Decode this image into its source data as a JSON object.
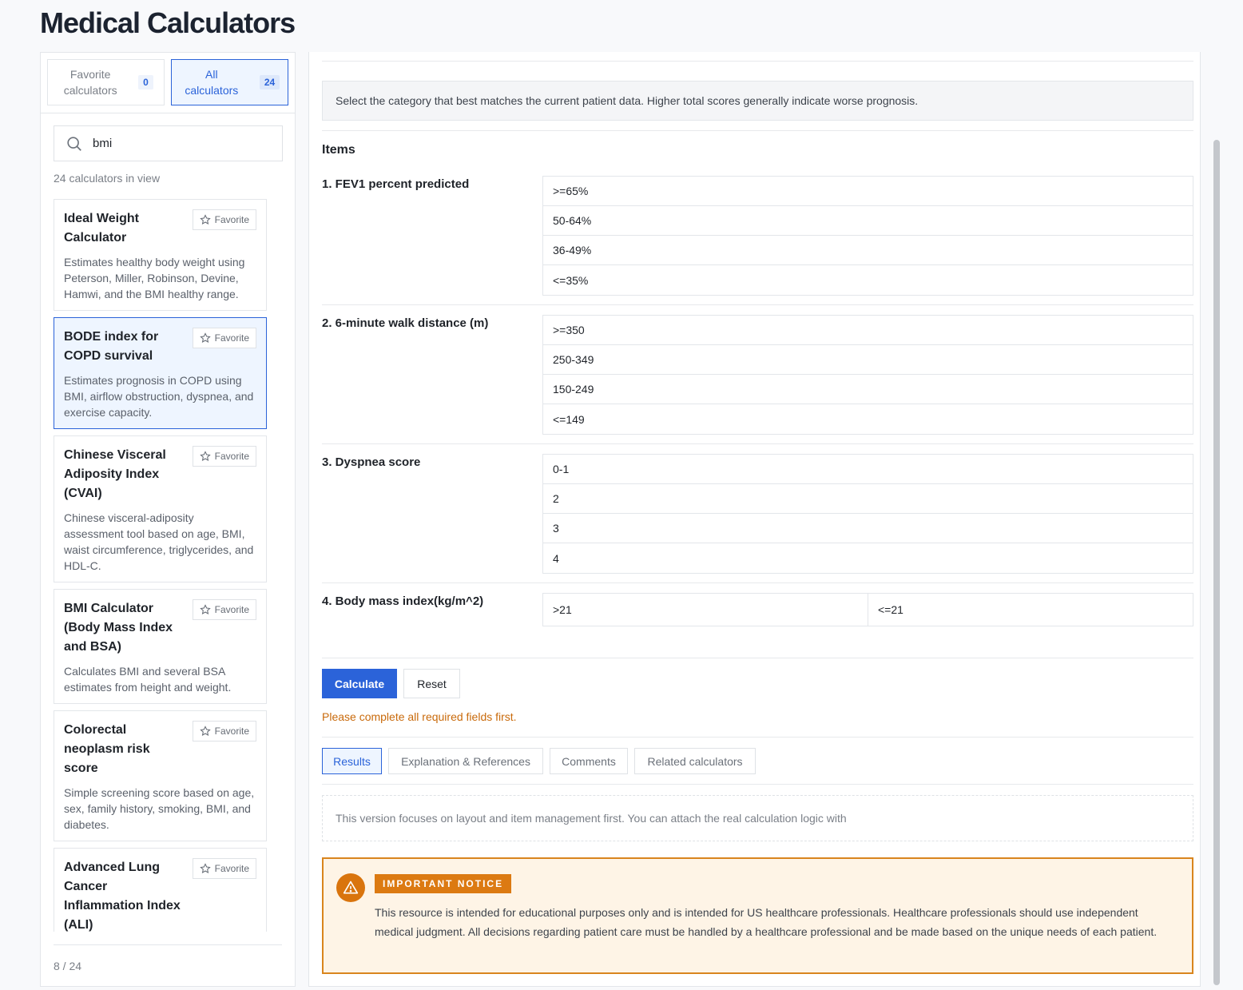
{
  "page": {
    "title": "Medical Calculators"
  },
  "sidebar": {
    "tabs": {
      "favorites": {
        "label": "Favorite calculators",
        "count": "0"
      },
      "all": {
        "label": "All calculators",
        "count": "24"
      }
    },
    "search": {
      "value": "bmi",
      "placeholder": ""
    },
    "in_view_text": "24 calculators in view",
    "favorite_label": "Favorite",
    "cards": [
      {
        "title": "Ideal Weight Calculator",
        "desc": "Estimates healthy body weight using Peterson, Miller, Robinson, Devine, Hamwi, and the BMI healthy range."
      },
      {
        "title": "BODE index for COPD survival",
        "desc": "Estimates prognosis in COPD using BMI, airflow obstruction, dyspnea, and exercise capacity."
      },
      {
        "title": "Chinese Visceral Adiposity Index (CVAI)",
        "desc": "Chinese visceral-adiposity assessment tool based on age, BMI, waist circumference, triglycerides, and HDL-C."
      },
      {
        "title": "BMI Calculator (Body Mass Index and BSA)",
        "desc": "Calculates BMI and several BSA estimates from height and weight."
      },
      {
        "title": "Colorectal neoplasm risk score",
        "desc": "Simple screening score based on age, sex, family history, smoking, BMI, and diabetes."
      },
      {
        "title": "Advanced Lung Cancer Inflammation Index (ALI)",
        "desc": ""
      }
    ],
    "pagination": "8 / 24"
  },
  "main": {
    "instruction": "Select the category that best matches the current patient data. Higher total scores generally indicate worse prognosis.",
    "items_heading": "Items",
    "questions": [
      {
        "label": "1. FEV1 percent predicted",
        "options": [
          ">=65%",
          "50-64%",
          "36-49%",
          "<=35%"
        ]
      },
      {
        "label": "2. 6-minute walk distance (m)",
        "options": [
          ">=350",
          "250-349",
          "150-249",
          "<=149"
        ]
      },
      {
        "label": "3. Dyspnea score",
        "options": [
          "0-1",
          "2",
          "3",
          "4"
        ]
      },
      {
        "label": "4. Body mass index(kg/m^2)",
        "options": [
          ">21",
          "<=21"
        ]
      }
    ],
    "calculate_label": "Calculate",
    "reset_label": "Reset",
    "warning": "Please complete all required fields first.",
    "result_tabs": [
      "Results",
      "Explanation & References",
      "Comments",
      "Related calculators"
    ],
    "result_text": "This version focuses on layout and item management first. You can attach the real calculation logic with",
    "notice": {
      "badge": "IMPORTANT NOTICE",
      "text": "This resource is intended for educational purposes only and is intended for US healthcare professionals. Healthcare professionals should use independent medical judgment. All decisions regarding patient care must be handled by a healthcare professional and be made based on the unique needs of each patient."
    }
  },
  "colors": {
    "accent": "#2b63d9",
    "warning": "#c96a0b",
    "notice_border": "#d9851d",
    "notice_bg": "#fef4e6"
  }
}
